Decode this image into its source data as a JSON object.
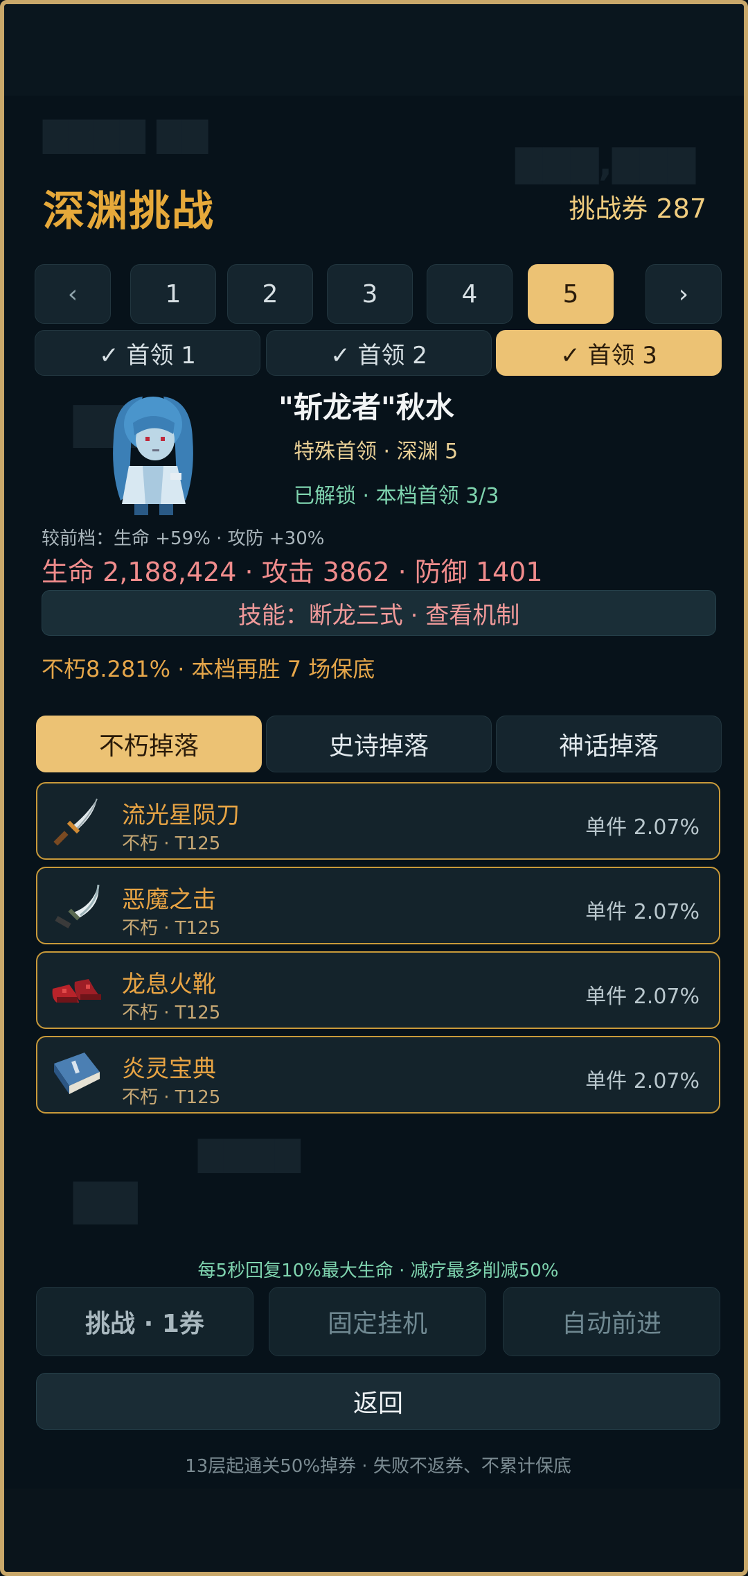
{
  "header": {
    "title": "深渊挑战",
    "tickets_label": "挑战券",
    "tickets_count": "287"
  },
  "pager": {
    "prev": "‹",
    "next": "›",
    "pages": [
      "1",
      "2",
      "3",
      "4",
      "5"
    ],
    "active_page": "5"
  },
  "bosses": [
    {
      "label": "✓ 首领 1"
    },
    {
      "label": "✓ 首领 2"
    },
    {
      "label": "✓ 首领 3"
    }
  ],
  "boss": {
    "name": "\"斩龙者\"秋水",
    "type": "特殊首领 · 深渊 5",
    "unlock": "已解锁 · 本档首领 3/3",
    "compare": "较前档：生命 +59% · 攻防 +30%",
    "stats": "生命 2,188,424 · 攻击 3862 · 防御 1401",
    "skill": "技能：断龙三式 · 查看机制",
    "guarantee": "不朽8.281% · 本档再胜 7 场保底"
  },
  "drop_tabs": [
    "不朽掉落",
    "史诗掉落",
    "神话掉落"
  ],
  "drops": [
    {
      "name": "流光星陨刀",
      "sub": "不朽 · T125",
      "rate": "单件 2.07%",
      "icon": "sword-icon"
    },
    {
      "name": "恶魔之击",
      "sub": "不朽 · T125",
      "rate": "单件 2.07%",
      "icon": "scimitar-icon"
    },
    {
      "name": "龙息火靴",
      "sub": "不朽 · T125",
      "rate": "单件 2.07%",
      "icon": "boots-icon"
    },
    {
      "name": "炎灵宝典",
      "sub": "不朽 · T125",
      "rate": "单件 2.07%",
      "icon": "book-icon"
    }
  ],
  "regen": "每5秒回复10%最大生命 · 减疗最多削减50%",
  "actions": {
    "challenge": "挑战 · 1券",
    "fixed": "固定挂机",
    "auto": "自动前进",
    "back": "返回"
  },
  "footnote": "13层起通关50%掉券 · 失败不返券、不累计保底",
  "colors": {
    "accent": "#ecc274",
    "title": "#e6a93a",
    "stat_red": "#f08c8c",
    "green": "#7ed3ae",
    "item_border": "#c99a3a"
  }
}
